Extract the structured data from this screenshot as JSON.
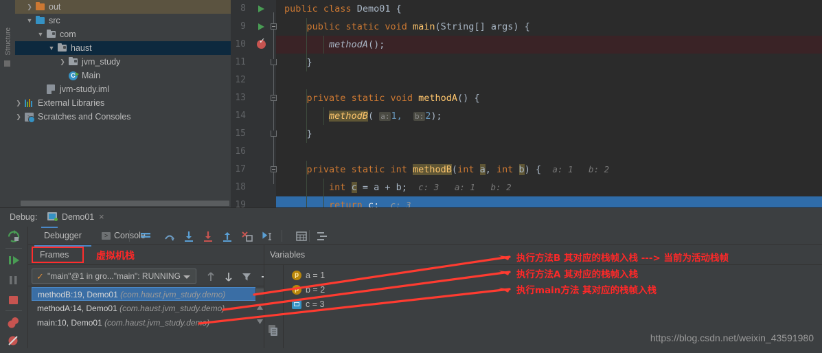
{
  "sidebar_rail": {
    "label": "Structure"
  },
  "project_tree": {
    "items": [
      {
        "label": "out",
        "icon": "folder-orange-icon",
        "arrow": "chevron-right",
        "depth": 1,
        "state": "highlighted"
      },
      {
        "label": "src",
        "icon": "folder-blue-icon",
        "arrow": "chevron-down",
        "depth": 1,
        "state": "normal"
      },
      {
        "label": "com",
        "icon": "package-icon",
        "arrow": "chevron-down",
        "depth": 2,
        "state": "normal"
      },
      {
        "label": "haust",
        "icon": "package-icon",
        "arrow": "chevron-down",
        "depth": 3,
        "state": "selected"
      },
      {
        "label": "jvm_study",
        "icon": "package-icon",
        "arrow": "chevron-right",
        "depth": 4,
        "state": "normal"
      },
      {
        "label": "Main",
        "icon": "java-class-runnable-icon",
        "arrow": "",
        "depth": 4,
        "state": "normal"
      },
      {
        "label": "jvm-study.iml",
        "icon": "module-file-icon",
        "arrow": "",
        "depth": 2,
        "state": "normal"
      },
      {
        "label": "External Libraries",
        "icon": "libraries-icon",
        "arrow": "chevron-right",
        "depth": 0,
        "state": "normal"
      },
      {
        "label": "Scratches and Consoles",
        "icon": "scratches-icon",
        "arrow": "chevron-right",
        "depth": 0,
        "state": "normal"
      }
    ]
  },
  "editor": {
    "lines": [
      {
        "num": "8",
        "gutter": "run-marker",
        "fold": "",
        "state": "normal"
      },
      {
        "num": "9",
        "gutter": "run-marker",
        "fold": "fold-start",
        "state": "normal"
      },
      {
        "num": "10",
        "gutter": "breakpoint-verified",
        "fold": "",
        "state": "breakpoint"
      },
      {
        "num": "11",
        "gutter": "",
        "fold": "fold-end",
        "state": "normal"
      },
      {
        "num": "12",
        "gutter": "",
        "fold": "",
        "state": "normal"
      },
      {
        "num": "13",
        "gutter": "",
        "fold": "fold-start",
        "state": "normal"
      },
      {
        "num": "14",
        "gutter": "",
        "fold": "",
        "state": "normal"
      },
      {
        "num": "15",
        "gutter": "",
        "fold": "fold-end",
        "state": "normal"
      },
      {
        "num": "16",
        "gutter": "",
        "fold": "",
        "state": "normal"
      },
      {
        "num": "17",
        "gutter": "",
        "fold": "fold-start",
        "state": "normal"
      },
      {
        "num": "18",
        "gutter": "",
        "fold": "",
        "state": "normal"
      },
      {
        "num": "19",
        "gutter": "",
        "fold": "",
        "state": "current"
      }
    ],
    "code": {
      "l8": "public class Demo01 {",
      "l9": "public static void main(String[] args) {",
      "l10": "methodA();",
      "l11": "}",
      "l13": "private static void methodA() {",
      "l14_call": "methodB(",
      "l14_hint_a": "a:",
      "l14_val_a": "1,",
      "l14_hint_b": "b:",
      "l14_val_b": "2",
      "l14_tail": ");",
      "l15": "}",
      "l17_sig": "private static int methodB(int a, int b) {",
      "l17_dbg": "a: 1   b: 2",
      "l18_code": "int c = a + b;",
      "l18_dbg": "c: 3   a: 1   b: 2",
      "l19_code": "return c;",
      "l19_dbg": "c: 3"
    }
  },
  "debug_window": {
    "label": "Debug:",
    "tab": {
      "title": "Demo01",
      "close": "×"
    },
    "toolbar": {
      "tabs": [
        {
          "label": "Debugger",
          "active": true
        },
        {
          "label": "Console",
          "active": false
        }
      ],
      "buttons": [
        "show-execution-point-icon",
        "step-over-icon",
        "step-into-icon",
        "force-step-into-icon",
        "step-out-icon",
        "drop-frame-icon",
        "run-to-cursor-icon",
        "evaluate-expression-icon",
        "settings-icon"
      ]
    },
    "rail_buttons": [
      "rerun-icon",
      "resume-program-icon",
      "pause-program-icon",
      "stop-icon",
      "view-breakpoints-icon",
      "mute-breakpoints-icon"
    ],
    "frames_panel": {
      "title": "Frames",
      "annotation": "虚拟机栈",
      "thread": {
        "value": "\"main\"@1 in gro...\"main\": RUNNING",
        "check": "✓"
      },
      "controls": [
        "up-arrow-icon",
        "down-arrow-icon",
        "filter-icon",
        "add-icon"
      ],
      "frames": [
        {
          "method": "methodB:19, Demo01",
          "package": "(com.haust.jvm_study.demo)",
          "selected": true
        },
        {
          "method": "methodA:14, Demo01",
          "package": "(com.haust.jvm_study.demo)",
          "selected": false
        },
        {
          "method": "main:10, Demo01",
          "package": "(com.haust.jvm_study.demo)",
          "selected": false
        }
      ]
    },
    "variables_panel": {
      "title": "Variables",
      "rows": [
        {
          "icon": "parameter-icon",
          "text": "a = 1"
        },
        {
          "icon": "parameter-icon",
          "text": "b = 2"
        },
        {
          "icon": "local-variable-icon",
          "text": "c = 3"
        }
      ]
    }
  },
  "annotations": {
    "notes": [
      "执行方法B 其对应的栈帧入栈  ---> 当前为活动栈帧",
      "执行方法A 其对应的栈帧入栈",
      "执行main方法 其对应的栈帧入栈"
    ],
    "arrow_color": "#ff3b30"
  },
  "watermark": {
    "text": "https://blog.csdn.net/weixin_43591980"
  }
}
